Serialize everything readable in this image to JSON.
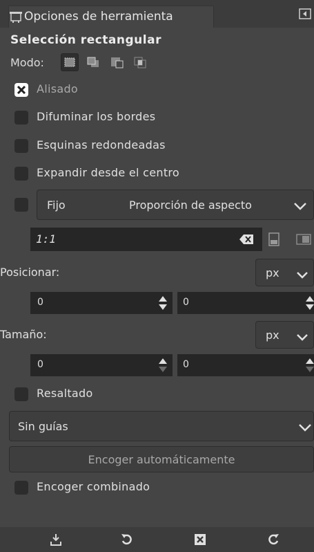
{
  "tab": {
    "label": "Opciones de herramienta"
  },
  "tool": {
    "title": "Selección rectangular"
  },
  "mode": {
    "label": "Modo:"
  },
  "options": {
    "antialias": {
      "label": "Alisado",
      "checked": true
    },
    "feather": {
      "label": "Difuminar los bordes",
      "checked": false
    },
    "rounded": {
      "label": "Esquinas redondeadas",
      "checked": false
    },
    "expand": {
      "label": "Expandir desde el centro",
      "checked": false
    }
  },
  "fixed": {
    "label": "Fijo",
    "value": "Proporción de aspecto",
    "ratio": "1:1"
  },
  "position": {
    "label": "Posicionar:",
    "unit": "px",
    "x": "0",
    "y": "0"
  },
  "size": {
    "label": "Tamaño:",
    "unit": "px",
    "w": "0",
    "h": "0"
  },
  "highlight": {
    "label": "Resaltado"
  },
  "guides": {
    "value": "Sin guías"
  },
  "autoshrink": {
    "label": "Encoger automáticamente"
  },
  "shrink_merged": {
    "label": "Encoger combinado"
  }
}
